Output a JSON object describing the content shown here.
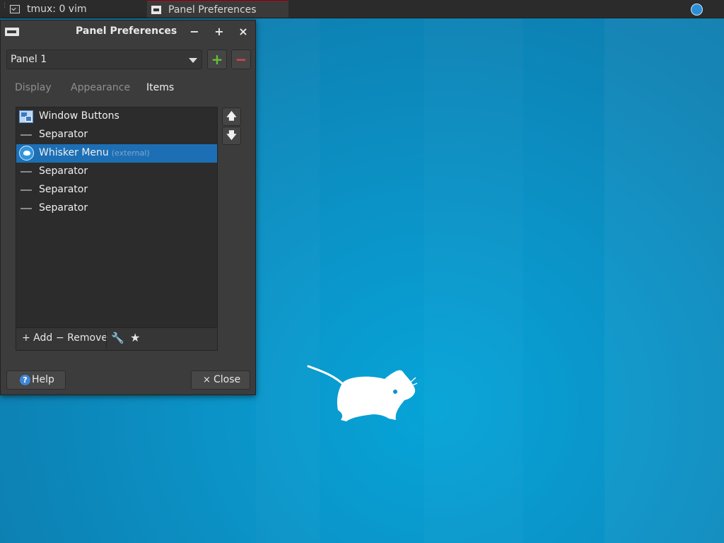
{
  "top_panel": {
    "tasks": [
      {
        "label": "tmux: 0 vim",
        "icon": "terminal-icon"
      },
      {
        "label": "Panel Preferences",
        "icon": "panel-preferences-icon",
        "active": true
      }
    ],
    "tray_icon": "xfce-mouse-icon"
  },
  "dialog": {
    "title": "Panel Preferences",
    "title_buttons": {
      "minimize": "−",
      "maximize": "+",
      "close": "×"
    },
    "panel_select": {
      "value": "Panel 1"
    },
    "add_panel": "+",
    "remove_panel": "−",
    "tabs": [
      {
        "label": "Display",
        "active": false
      },
      {
        "label": "Appearance",
        "active": false
      },
      {
        "label": "Items",
        "active": true
      }
    ],
    "items": [
      {
        "label": "Window Buttons",
        "suffix": "",
        "icon": "window-buttons-icon",
        "selected": false
      },
      {
        "label": "Separator",
        "suffix": "",
        "icon": "separator-icon",
        "selected": false
      },
      {
        "label": "Whisker Menu",
        "suffix": "(external)",
        "icon": "whisker-menu-icon",
        "selected": true
      },
      {
        "label": "Separator",
        "suffix": "",
        "icon": "separator-icon",
        "selected": false
      },
      {
        "label": "Separator",
        "suffix": "",
        "icon": "separator-icon",
        "selected": false
      },
      {
        "label": "Separator",
        "suffix": "",
        "icon": "separator-icon",
        "selected": false
      }
    ],
    "list_toolbar": {
      "add": "+ Add",
      "remove": "− Remove",
      "wrench": "🔧",
      "star": "★"
    },
    "move_up": "🡅",
    "move_down": "🡇",
    "help": "Help",
    "help_glyph": "?",
    "close": "Close",
    "close_glyph": "×"
  },
  "colors": {
    "selection": "#1d6fb5",
    "add_green": "#63c13b",
    "remove_red": "#e0444a",
    "desktop": "#0b93c7"
  }
}
